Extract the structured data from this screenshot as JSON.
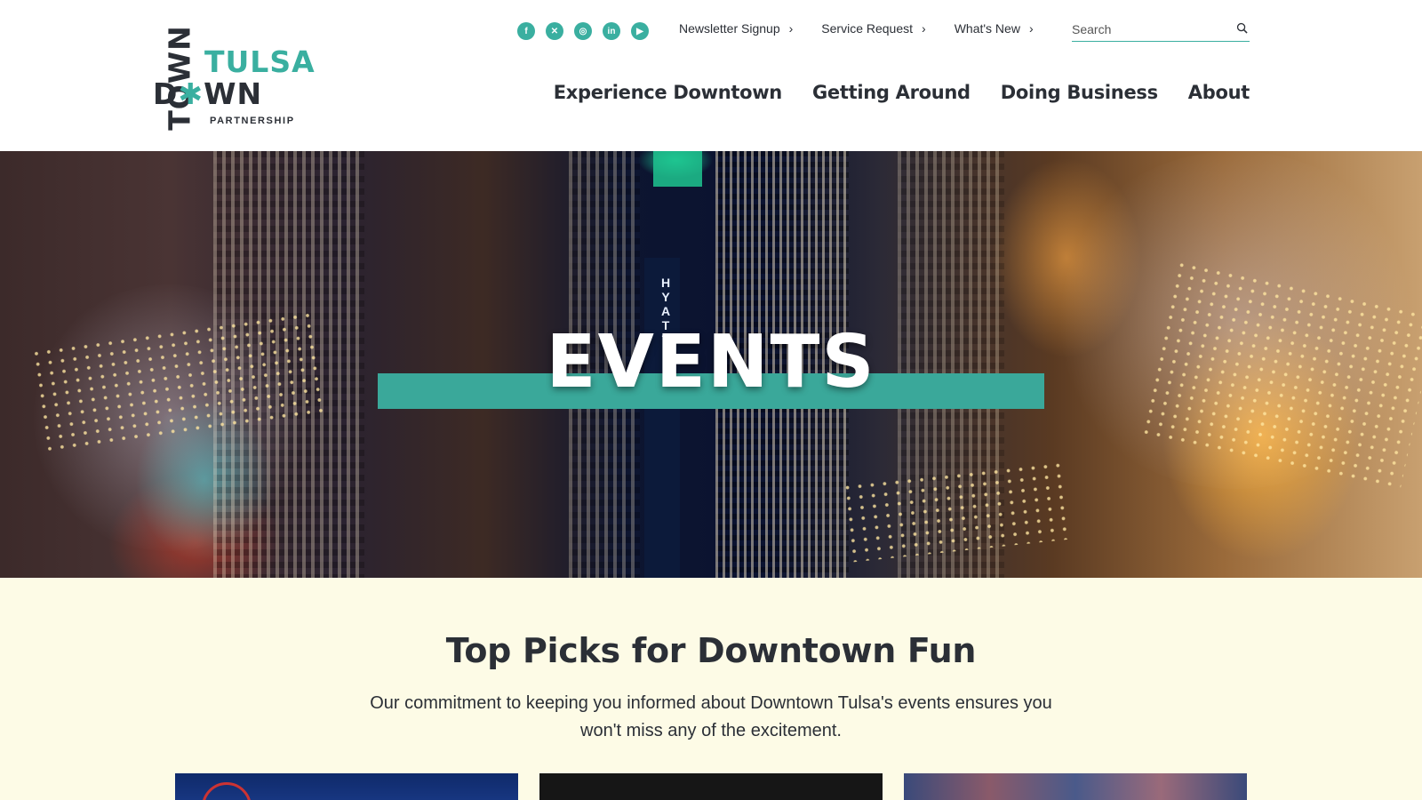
{
  "logo": {
    "town": "TOWN",
    "tulsa": "TULSA",
    "down": "DOWN",
    "partnership": "PARTNERSHIP"
  },
  "socials": [
    {
      "name": "facebook-icon",
      "glyph": "f"
    },
    {
      "name": "x-icon",
      "glyph": "✕"
    },
    {
      "name": "instagram-icon",
      "glyph": "◎"
    },
    {
      "name": "linkedin-icon",
      "glyph": "in"
    },
    {
      "name": "youtube-icon",
      "glyph": "▶"
    }
  ],
  "utility_links": [
    {
      "label": "Newsletter Signup"
    },
    {
      "label": "Service Request"
    },
    {
      "label": "What's New"
    }
  ],
  "search": {
    "placeholder": "Search"
  },
  "main_nav": [
    {
      "label": "Experience Downtown"
    },
    {
      "label": "Getting Around"
    },
    {
      "label": "Doing Business"
    },
    {
      "label": "About"
    }
  ],
  "hero": {
    "title": "EVENTS",
    "sign_text": "HYATT"
  },
  "section": {
    "title": "Top Picks for Downtown Fun",
    "description": "Our commitment to keeping you informed about Downtown Tulsa's events ensures you won't miss any of the excitement."
  },
  "colors": {
    "accent": "#3aafa0",
    "text": "#2b2f36",
    "background": "#fdfbe6"
  }
}
